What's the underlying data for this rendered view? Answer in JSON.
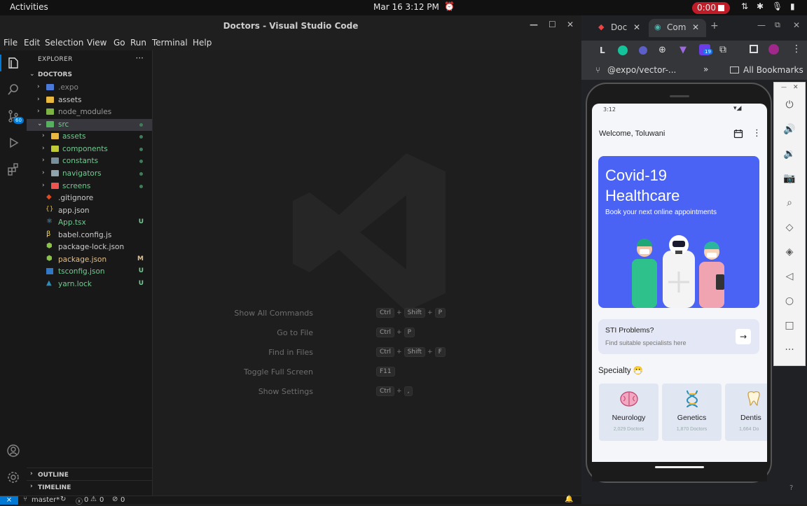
{
  "topbar": {
    "activities": "Activities",
    "clock": "Mar 16  3:12 PM",
    "recording": "0:00"
  },
  "vscode": {
    "title": "Doctors - Visual Studio Code",
    "menu": [
      "File",
      "Edit",
      "Selection",
      "View",
      "Go",
      "Run",
      "Terminal",
      "Help"
    ],
    "scm_badge": "60",
    "explorer_label": "EXPLORER",
    "root": "DOCTORS",
    "tree": [
      {
        "label": ".expo",
        "status": ""
      },
      {
        "label": "assets",
        "status": ""
      },
      {
        "label": "node_modules",
        "status": ""
      },
      {
        "label": "src",
        "status": ""
      },
      {
        "label": "assets",
        "status": ""
      },
      {
        "label": "components",
        "status": ""
      },
      {
        "label": "constants",
        "status": ""
      },
      {
        "label": "navigators",
        "status": ""
      },
      {
        "label": "screens",
        "status": ""
      },
      {
        "label": ".gitignore",
        "status": ""
      },
      {
        "label": "app.json",
        "status": ""
      },
      {
        "label": "App.tsx",
        "status": "U"
      },
      {
        "label": "babel.config.js",
        "status": ""
      },
      {
        "label": "package-lock.json",
        "status": ""
      },
      {
        "label": "package.json",
        "status": "M"
      },
      {
        "label": "tsconfig.json",
        "status": "U"
      },
      {
        "label": "yarn.lock",
        "status": "U"
      }
    ],
    "outline": "OUTLINE",
    "timeline": "TIMELINE",
    "hints": [
      {
        "name": "Show All Commands",
        "keys": [
          "Ctrl",
          "Shift",
          "P"
        ]
      },
      {
        "name": "Go to File",
        "keys": [
          "Ctrl",
          "P"
        ]
      },
      {
        "name": "Find in Files",
        "keys": [
          "Ctrl",
          "Shift",
          "F"
        ]
      },
      {
        "name": "Toggle Full Screen",
        "keys": [
          "F11"
        ]
      },
      {
        "name": "Show Settings",
        "keys": [
          "Ctrl",
          ","
        ]
      }
    ],
    "status": {
      "branch": "master*",
      "errors": "0",
      "warnings": "0",
      "ports": "0"
    }
  },
  "chrome": {
    "tab1": "Doc",
    "tab2": "Com",
    "toolbar_L": "L",
    "ext_badge": "19",
    "bookmark1": "@expo/vector-...",
    "all_bookmarks": "All Bookmarks"
  },
  "app": {
    "time": "3:12",
    "welcome": "Welcome, Toluwani",
    "hero_title_1": "Covid-19",
    "hero_title_2": "Healthcare",
    "hero_sub": "Book your next online appointments",
    "sti_title": "STI Problems?",
    "sti_sub": "Find suitable specialists here",
    "specialty_heading": "Specialty 😷",
    "specialties": [
      {
        "name": "Neurology",
        "count": "2,029 Doctors"
      },
      {
        "name": "Genetics",
        "count": "1,870 Doctors"
      },
      {
        "name": "Dentis",
        "count": "1,664 Do"
      }
    ]
  },
  "colors": {
    "hero": "#4a63f5",
    "vscode_accent": "#0078d4",
    "git_untracked": "#73c991",
    "git_modified": "#e2c08d"
  }
}
